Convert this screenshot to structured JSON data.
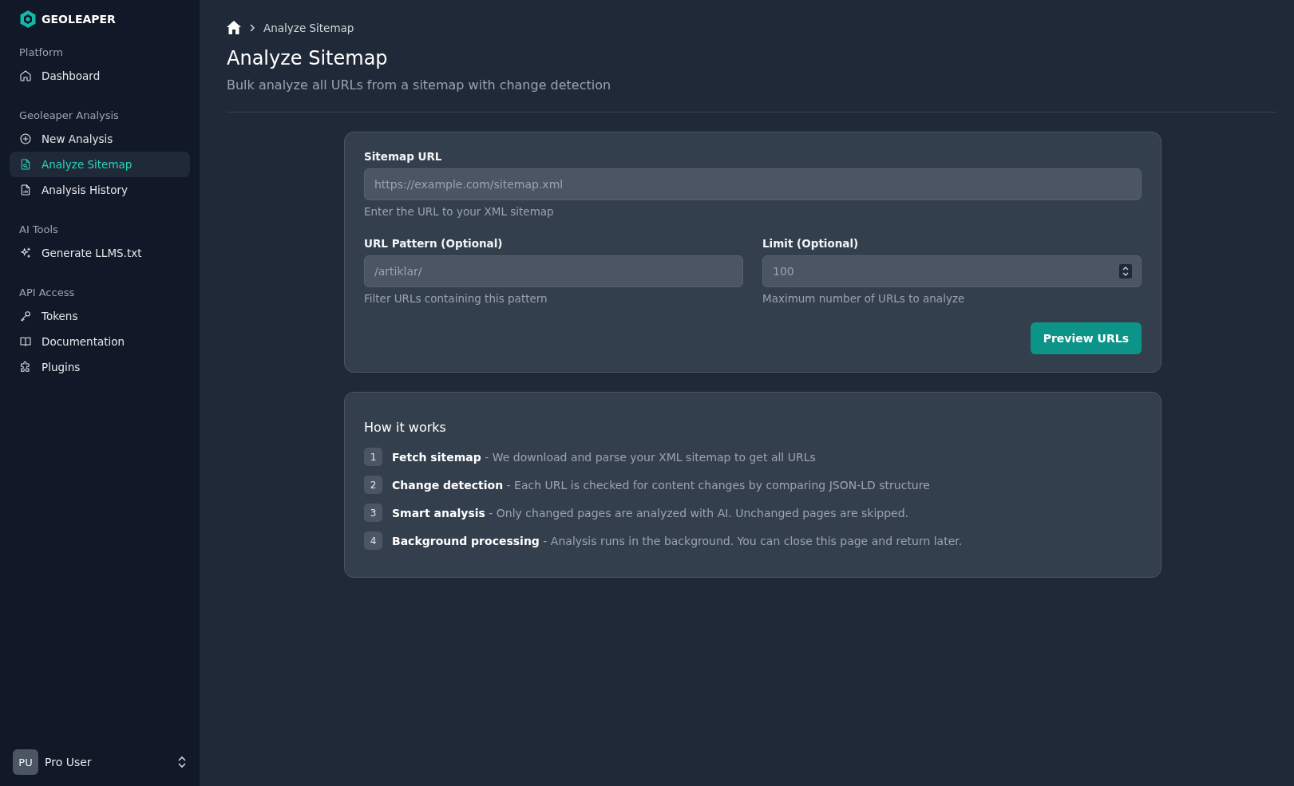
{
  "brand": {
    "name": "GEOLEAPER"
  },
  "sidebar": {
    "groups": [
      {
        "label": "Platform",
        "items": [
          {
            "label": "Dashboard",
            "selected": false
          }
        ]
      },
      {
        "label": "Geoleaper Analysis",
        "items": [
          {
            "label": "New Analysis",
            "selected": false
          },
          {
            "label": "Analyze Sitemap",
            "selected": true
          },
          {
            "label": "Analysis History",
            "selected": false
          }
        ]
      },
      {
        "label": "AI Tools",
        "items": [
          {
            "label": "Generate LLMS.txt",
            "selected": false
          }
        ]
      },
      {
        "label": "API Access",
        "items": [
          {
            "label": "Tokens",
            "selected": false
          },
          {
            "label": "Documentation",
            "selected": false
          },
          {
            "label": "Plugins",
            "selected": false
          }
        ]
      }
    ],
    "user": {
      "initials": "PU",
      "name": "Pro User"
    }
  },
  "breadcrumb": {
    "current": "Analyze Sitemap"
  },
  "page": {
    "title": "Analyze Sitemap",
    "subtitle": "Bulk analyze all URLs from a sitemap with change detection"
  },
  "form": {
    "sitemap": {
      "label": "Sitemap URL",
      "placeholder": "https://example.com/sitemap.xml",
      "help": "Enter the URL to your XML sitemap"
    },
    "pattern": {
      "label": "URL Pattern (Optional)",
      "placeholder": "/artiklar/",
      "help": "Filter URLs containing this pattern"
    },
    "limit": {
      "label": "Limit (Optional)",
      "placeholder": "100",
      "help": "Maximum number of URLs to analyze"
    },
    "button": "Preview URLs"
  },
  "how_it_works": {
    "title": "How it works",
    "steps": [
      {
        "number": "1",
        "text": "**Fetch sitemap** - We download and parse your XML sitemap to get all URLs"
      },
      {
        "number": "2",
        "text": "**Change detection** - Each URL is checked for content changes by comparing JSON-LD structure"
      },
      {
        "number": "3",
        "text": "**Smart analysis** - Only changed pages are analyzed with AI. Unchanged pages are skipped."
      },
      {
        "number": "4",
        "text": "**Background processing** - Analysis runs in the background. You can close this page and return later."
      }
    ]
  }
}
